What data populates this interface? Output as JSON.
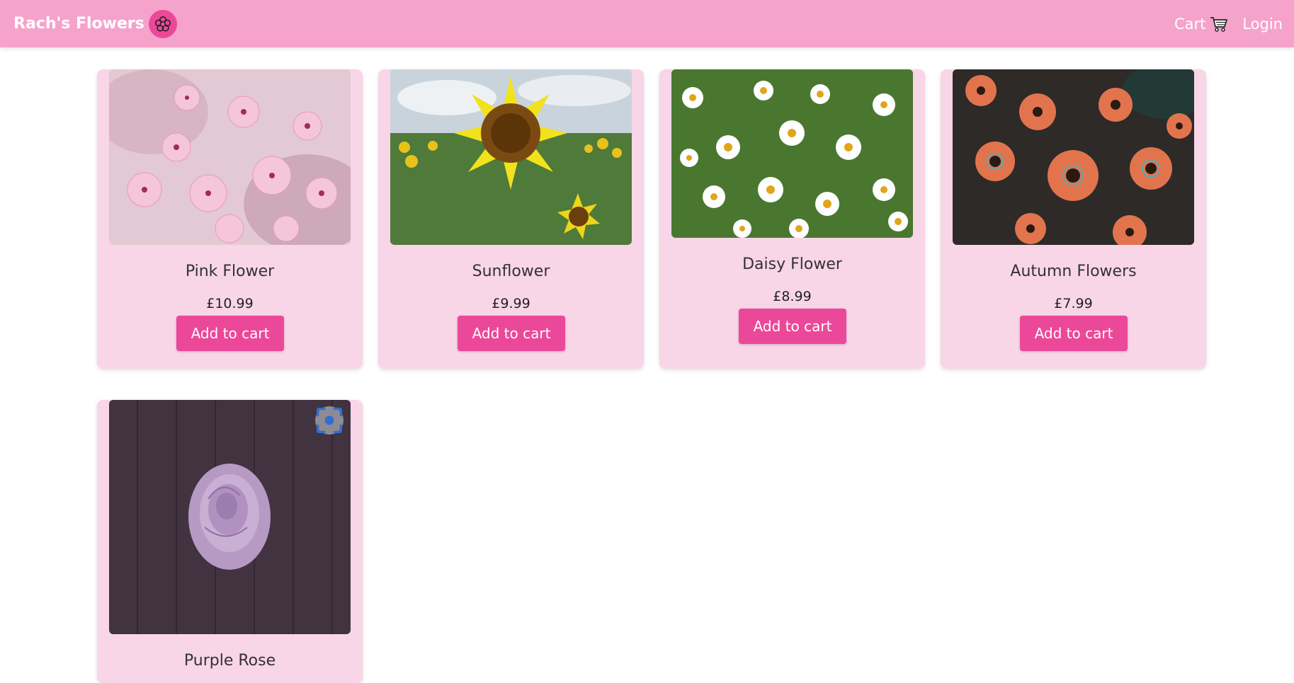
{
  "navbar": {
    "brand": "Rach's Flowers",
    "logo_icon": "flower-icon",
    "cart_label": "Cart",
    "cart_icon": "cart-icon",
    "login_label": "Login",
    "background_color": "#f5a3cb"
  },
  "products": [
    {
      "title": "Pink Flower",
      "price": "£10.99",
      "button": "Add to cart",
      "image": "pink-cherry-blossoms"
    },
    {
      "title": "Sunflower",
      "price": "£9.99",
      "button": "Add to cart",
      "image": "sunflower-field"
    },
    {
      "title": "Daisy Flower",
      "price": "£8.99",
      "button": "Add to cart",
      "image": "white-daisies"
    },
    {
      "title": "Autumn Flowers",
      "price": "£7.99",
      "button": "Add to cart",
      "image": "orange-daisies-dark"
    },
    {
      "title": "Purple Rose",
      "image": "purple-rose-on-wood",
      "overlay_icon": "visual-search-icon"
    }
  ],
  "colors": {
    "accent": "#ec4899",
    "card_background": "#f9d5e8"
  }
}
